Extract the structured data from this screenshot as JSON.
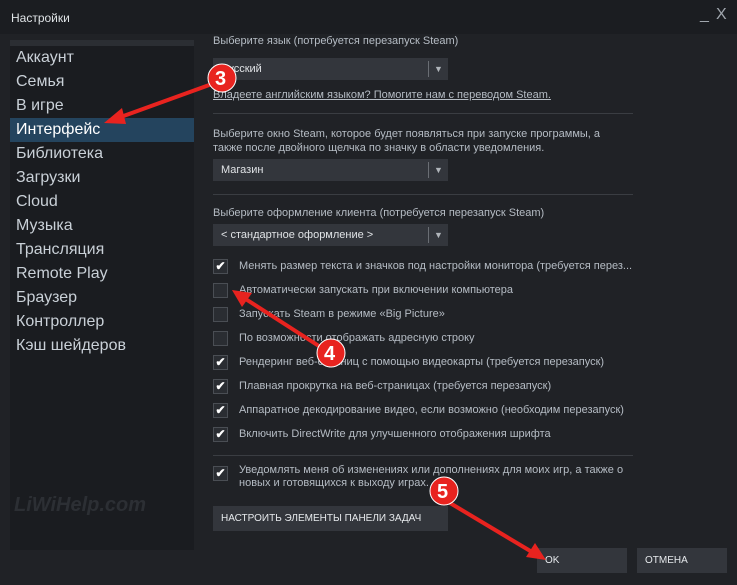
{
  "window": {
    "title": "Настройки",
    "minimize": "_",
    "close": "X"
  },
  "sidebar": {
    "items": [
      {
        "label": "Аккаунт"
      },
      {
        "label": "Семья"
      },
      {
        "label": "В игре"
      },
      {
        "label": "Интерфейс",
        "selected": true
      },
      {
        "label": "Библиотека"
      },
      {
        "label": "Загрузки"
      },
      {
        "label": "Cloud"
      },
      {
        "label": "Музыка"
      },
      {
        "label": "Трансляция"
      },
      {
        "label": "Remote Play"
      },
      {
        "label": "Браузер"
      },
      {
        "label": "Контроллер"
      },
      {
        "label": "Кэш шейдеров"
      }
    ]
  },
  "main": {
    "language_label": "Выберите язык (потребуется перезапуск Steam)",
    "language_value": "Русский",
    "translate_link": "Владеете английским языком? Помогите нам с переводом Steam.",
    "window_label": "Выберите окно Steam, которое будет появляться при запуске программы, а также после двойного щелчка по значку в области уведомления.",
    "window_value": "Магазин",
    "skin_label": "Выберите оформление клиента (потребуется перезапуск Steam)",
    "skin_value": "< стандартное оформление >",
    "checkboxes": [
      {
        "label": "Менять размер текста и значков под настройки монитора (требуется перез...",
        "checked": true
      },
      {
        "label": "Автоматически запускать при включении компьютера",
        "checked": false
      },
      {
        "label": "Запускать Steam в режиме «Big Picture»",
        "checked": false
      },
      {
        "label": "По возможности отображать адресную строку",
        "checked": false
      },
      {
        "label": "Рендеринг веб-страниц с помощью видеокарты (требуется перезапуск)",
        "checked": true
      },
      {
        "label": "Плавная прокрутка на веб-страницах (требуется перезапуск)",
        "checked": true
      },
      {
        "label": "Аппаратное декодирование видео, если возможно (необходим перезапуск)",
        "checked": true
      },
      {
        "label": "Включить DirectWrite для улучшенного отображения шрифта",
        "checked": true
      }
    ],
    "notify": {
      "label": "Уведомлять меня об изменениях или дополнениях для моих игр, а также о новых и готовящихся к выходу играх.",
      "checked": true
    },
    "taskbar_button": "НАСТРОИТЬ ЭЛЕМЕНТЫ ПАНЕЛИ ЗАДАЧ"
  },
  "footer": {
    "ok": "OK",
    "cancel": "ОТМЕНА"
  },
  "annotations": {
    "color": "#e8231f",
    "steps": [
      "3",
      "4",
      "5"
    ]
  },
  "watermark": "LiWiHelp.com"
}
